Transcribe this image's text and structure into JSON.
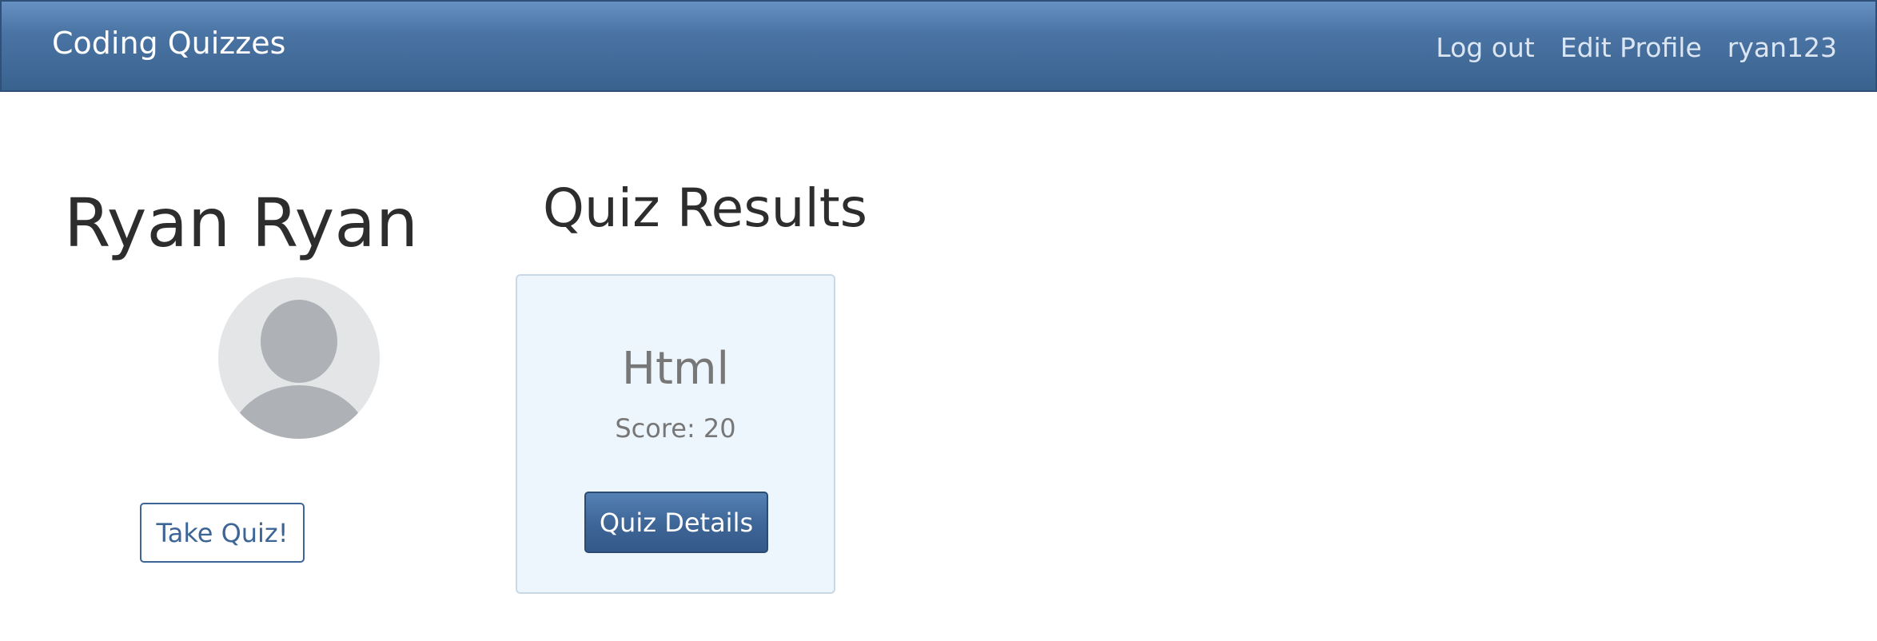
{
  "navbar": {
    "brand": "Coding Quizzes",
    "links": [
      "Log out",
      "Edit Profile",
      "ryan123"
    ]
  },
  "profile": {
    "name": "Ryan Ryan",
    "avatar_icon": "user-avatar-placeholder-icon",
    "take_quiz_label": "Take Quiz!"
  },
  "results": {
    "heading": "Quiz Results",
    "cards": [
      {
        "title": "Html",
        "score": "Score: 20",
        "button_label": "Quiz Details"
      }
    ]
  },
  "colors": {
    "navbar": "#4a74a4",
    "primary": "#3d6596",
    "card_background": "#eef6fd",
    "avatar_background": "#e4e5e7",
    "avatar_silhouette": "#aeb2b6"
  }
}
